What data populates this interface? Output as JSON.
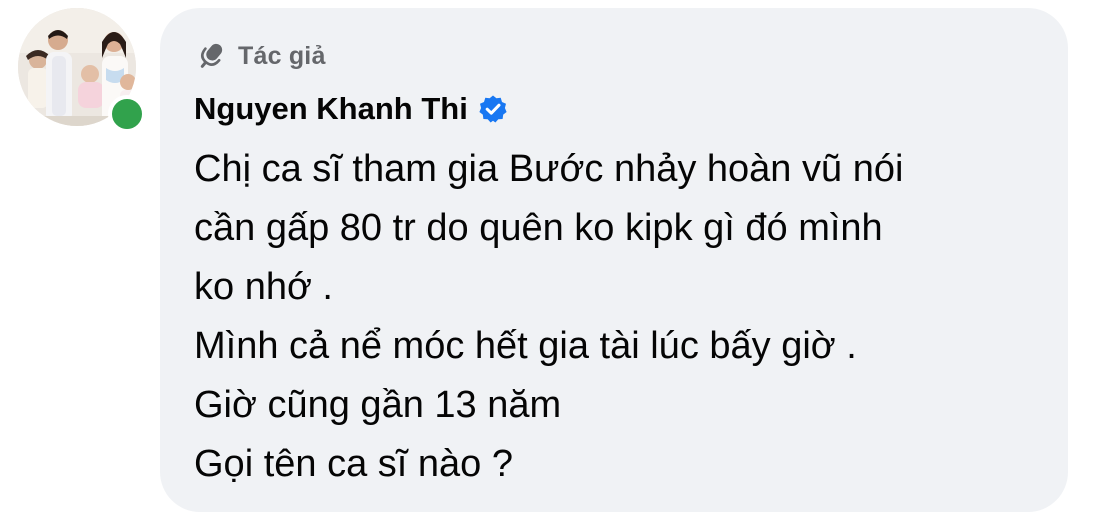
{
  "avatar": {
    "icon": "profile-photo",
    "online": true,
    "online_color": "#31a24c"
  },
  "badge": {
    "icon": "microphone-icon",
    "label": "Tác giả"
  },
  "author": {
    "name": "Nguyen Khanh Thi",
    "verified_icon": "verified-badge-icon",
    "verified_color": "#1877f2"
  },
  "comment": {
    "lines": [
      "Chị ca sĩ tham gia Bước nhảy hoàn vũ nói",
      "cần gấp 80 tr do quên ko kipk gì đó mình",
      "ko nhớ .",
      "Mình cả nể móc hết gia tài lúc bấy giờ .",
      "Giờ cũng gần 13 năm",
      "Gọi tên ca sĩ nào ?"
    ]
  },
  "colors": {
    "bubble": "#f0f2f5",
    "text": "#050505",
    "muted": "#65676b"
  }
}
